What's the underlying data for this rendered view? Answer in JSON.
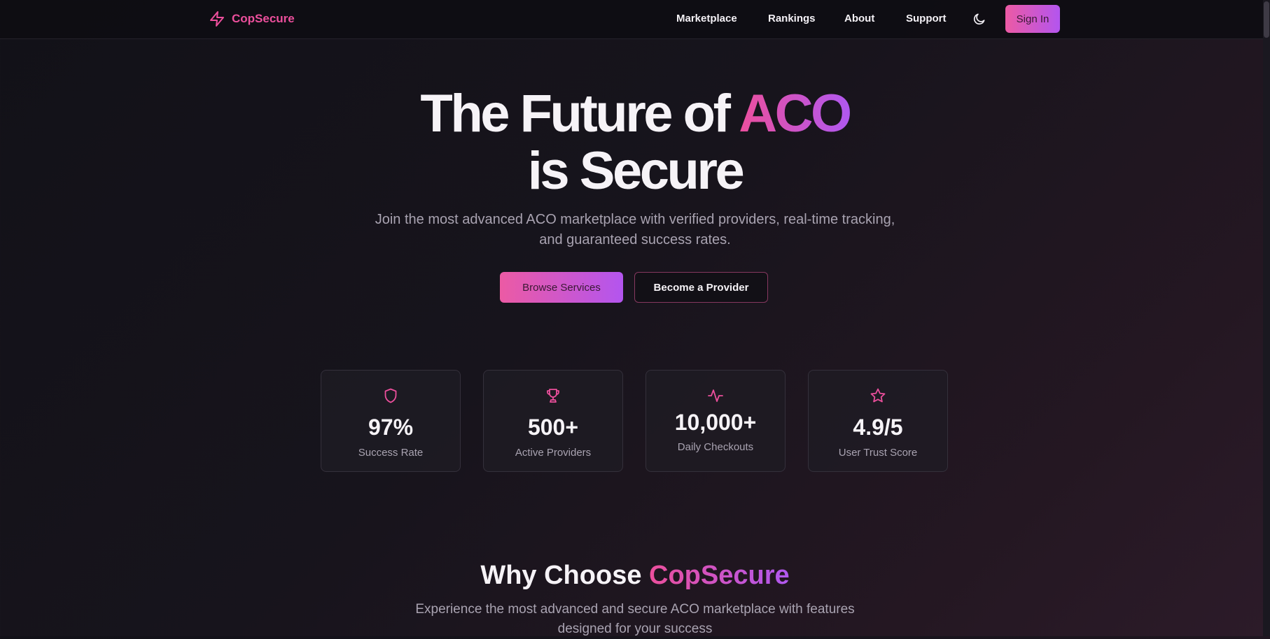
{
  "nav": {
    "brand": "CopSecure",
    "links": [
      "Marketplace",
      "Rankings",
      "About",
      "Support"
    ],
    "sign_in": "Sign In"
  },
  "hero": {
    "title_part1": "The Future of",
    "title_accent": "ACO",
    "title_line2": "is Secure",
    "subtitle": "Join the most advanced ACO marketplace with verified providers, real-time tracking, and guaranteed success rates.",
    "primary_cta": "Browse Services",
    "secondary_cta": "Become a Provider"
  },
  "stats": [
    {
      "value": "97%",
      "label": "Success Rate",
      "icon": "shield-icon"
    },
    {
      "value": "500+",
      "label": "Active Providers",
      "icon": "trophy-icon"
    },
    {
      "value": "10,000+",
      "label": "Daily Checkouts",
      "icon": "activity-icon"
    },
    {
      "value": "4.9/5",
      "label": "User Trust Score",
      "icon": "star-icon"
    }
  ],
  "why": {
    "title_part1": "Why Choose",
    "title_accent": "CopSecure",
    "subtitle": "Experience the most advanced and secure ACO marketplace with features designed for your success"
  },
  "colors": {
    "accent_pink": "#ec4f9c",
    "accent_purple": "#b058f0",
    "background": "#121118",
    "muted_text": "#a9a3b1"
  }
}
